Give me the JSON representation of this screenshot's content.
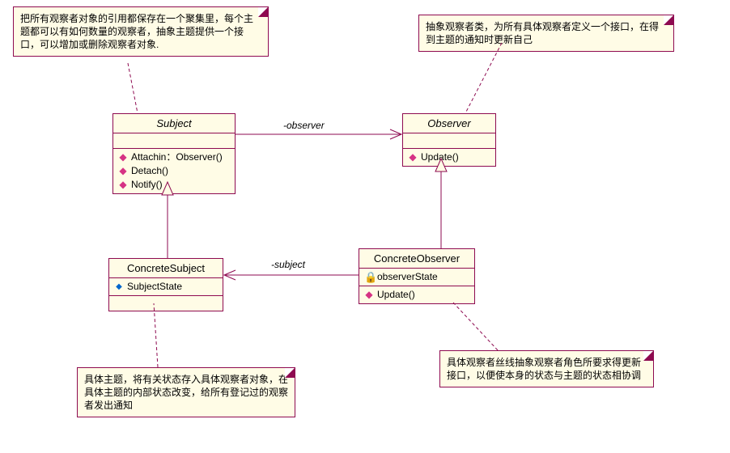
{
  "notes": {
    "subject_note": "把所有观察者对象的引用都保存在一个聚集里，每个主题都可以有如何数量的观察者，抽象主题提供一个接口，可以增加或删除观察者对象.",
    "observer_note": "抽象观察者类，为所有具体观察者定义一个接口，在得到主题的通知时更新自己",
    "concrete_subject_note": "具体主题，将有关状态存入具体观察者对象，在具体主题的内部状态改变，给所有登记过的观察者发出通知",
    "concrete_observer_note": "具体观察者丝线抽象观察者角色所要求得更新接口，以便使本身的状态与主题的状态相协调"
  },
  "classes": {
    "subject": {
      "name": "Subject",
      "ops": [
        "Attachin：Observer()",
        "Detach()",
        "Notify()"
      ]
    },
    "observer": {
      "name": "Observer",
      "ops": [
        "Update()"
      ]
    },
    "concrete_subject": {
      "name": "ConcreteSubject",
      "attrs": [
        "SubjectState"
      ]
    },
    "concrete_observer": {
      "name": "ConcreteObserver",
      "attrs": [
        "observerState"
      ],
      "ops": [
        "Update()"
      ]
    }
  },
  "assoc": {
    "observer_label": "-observer",
    "subject_label": "-subject"
  }
}
